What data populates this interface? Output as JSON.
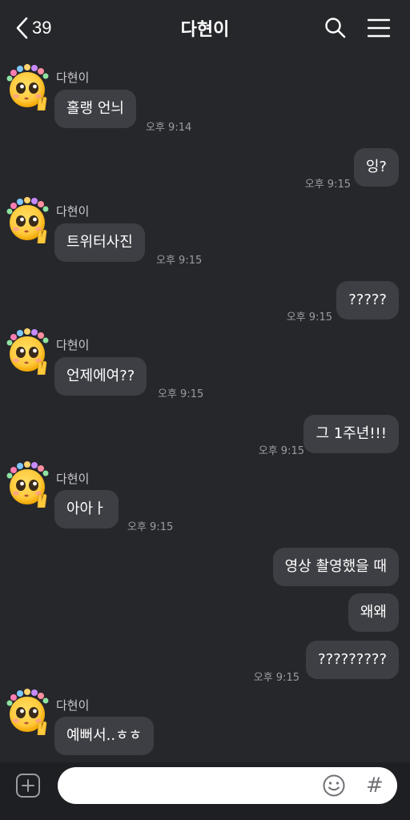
{
  "header": {
    "back_count": "39",
    "title": "다현이"
  },
  "messages": [
    {
      "side": "left",
      "sender": "다현이",
      "text": "홀랭 언늬",
      "time": "오후 9:14"
    },
    {
      "side": "right",
      "text": "잉?",
      "time": "오후 9:15"
    },
    {
      "side": "left",
      "sender": "다현이",
      "text": "트위터사진",
      "time": "오후 9:15"
    },
    {
      "side": "right",
      "text": "?????",
      "time": "오후 9:15"
    },
    {
      "side": "left",
      "sender": "다현이",
      "text": "언제에여??",
      "time": "오후 9:15"
    },
    {
      "side": "right",
      "text": "그 1주년!!!",
      "time": "오후 9:15"
    },
    {
      "side": "left",
      "sender": "다현이",
      "text": "아아ㅏ",
      "time": "오후 9:15"
    },
    {
      "side": "right",
      "text": "영상 촬영했을 때"
    },
    {
      "side": "right",
      "text": "왜왜"
    },
    {
      "side": "right",
      "text": "?????????",
      "time": "오후 9:15"
    },
    {
      "side": "left",
      "sender": "다현이",
      "text": "예뻐서..ㅎㅎ"
    }
  ],
  "input": {
    "value": "",
    "placeholder": ""
  },
  "icons": {
    "back": "chevron-left-icon",
    "search": "search-icon",
    "menu": "menu-icon",
    "plus": "plus-icon",
    "emoji": "emoji-icon",
    "hash": "hash-icon",
    "avatar": "pleading-face-emoji"
  },
  "colors": {
    "background": "#26272b",
    "bubble": "#3e3f44",
    "input_bar": "#1e1f22"
  }
}
